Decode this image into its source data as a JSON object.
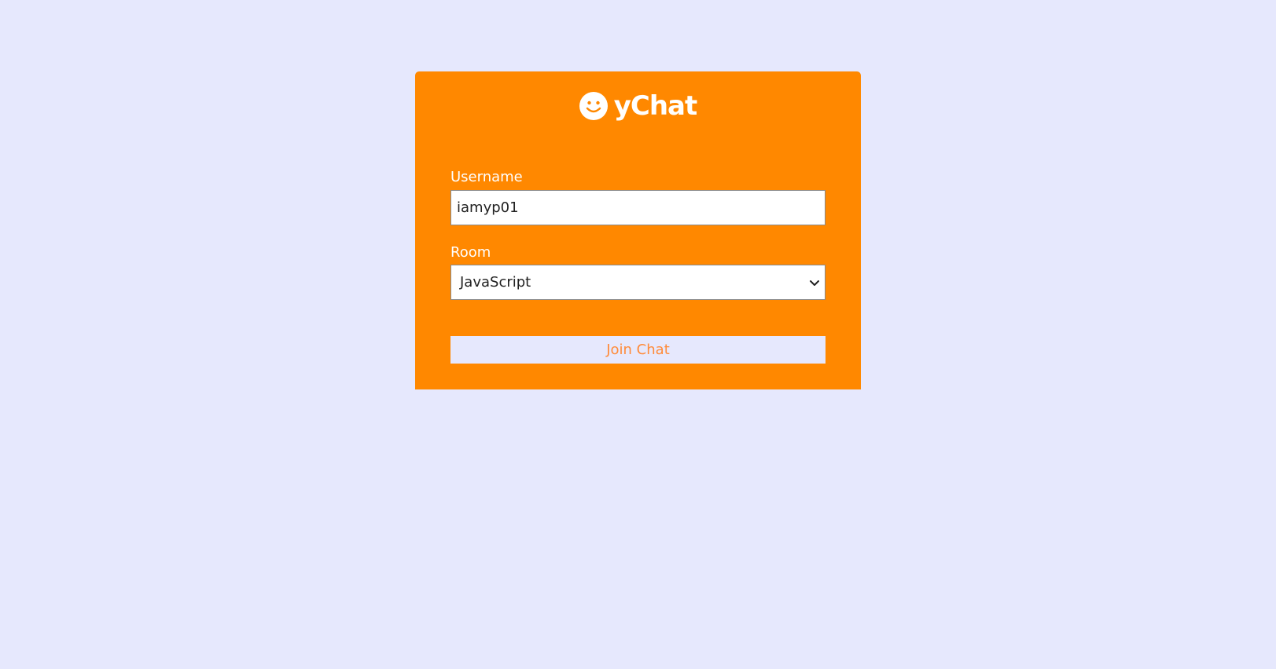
{
  "app": {
    "name": "yChat",
    "logo_icon": "smiley-icon"
  },
  "form": {
    "username": {
      "label": "Username",
      "value": "iamyp01"
    },
    "room": {
      "label": "Room",
      "selected": "JavaScript",
      "dropdown_icon": "chevron-down-icon"
    },
    "join_button_label": "Join Chat"
  },
  "colors": {
    "background": "#e6e8fd",
    "card": "#ff8800",
    "button_text": "#ff8b3a",
    "text_on_card": "#ffffff"
  }
}
